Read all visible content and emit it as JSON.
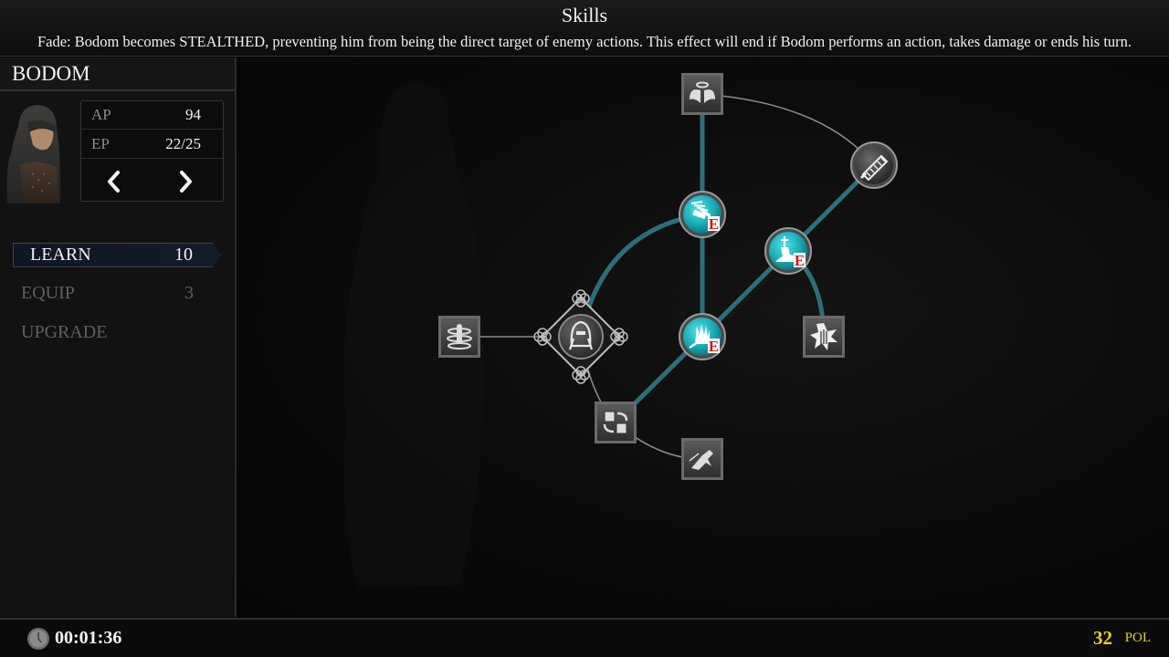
{
  "header": {
    "title": "Skills",
    "description": "Fade: Bodom becomes STEALTHED, preventing him from being the direct target of enemy actions. This effect will end if Bodom performs an action, takes damage or ends his turn."
  },
  "character": {
    "name": "BODOM",
    "stats": [
      {
        "label": "AP",
        "value": "94"
      },
      {
        "label": "EP",
        "value": "22/25"
      }
    ],
    "prev_icon": "chevron-left-icon",
    "next_icon": "chevron-right-icon"
  },
  "menu": [
    {
      "label": "LEARN",
      "count": "10",
      "active": true
    },
    {
      "label": "EQUIP",
      "count": "3",
      "active": false
    },
    {
      "label": "UPGRADE",
      "count": "",
      "active": false
    }
  ],
  "skill_tree": {
    "colors": {
      "learned_link": "#2b6f7c",
      "unlearned_link": "#8a8a8a",
      "learned_node": "#1fb8c4",
      "equipped_badge": "#d01818"
    },
    "nodes": [
      {
        "id": "root",
        "icon": "hooded-figure-icon",
        "kind": "root",
        "learned": true,
        "equipped": false
      },
      {
        "id": "whirl",
        "icon": "whirlwind-figure-icon",
        "kind": "passive",
        "learned": false,
        "equipped": false
      },
      {
        "id": "wings",
        "icon": "winged-halo-icon",
        "kind": "passive",
        "learned": false,
        "equipped": false
      },
      {
        "id": "bandage",
        "icon": "bandaged-hand-icon",
        "kind": "active",
        "learned": true,
        "equipped": true,
        "badge": "E"
      },
      {
        "id": "claw",
        "icon": "clawed-gauntlet-icon",
        "kind": "active",
        "learned": true,
        "equipped": true,
        "badge": "E"
      },
      {
        "id": "kneel",
        "icon": "kneeling-swordsman-icon",
        "kind": "active",
        "learned": true,
        "equipped": true,
        "badge": "E"
      },
      {
        "id": "blade",
        "icon": "serrated-blade-icon",
        "kind": "active",
        "learned": false,
        "equipped": false
      },
      {
        "id": "burst",
        "icon": "fist-burst-icon",
        "kind": "passive",
        "learned": false,
        "equipped": false
      },
      {
        "id": "swap",
        "icon": "swap-squares-icon",
        "kind": "passive",
        "learned": true,
        "equipped": false
      },
      {
        "id": "dash",
        "icon": "dashing-figure-icon",
        "kind": "passive",
        "learned": false,
        "equipped": false
      }
    ],
    "links": [
      {
        "from": "whirl",
        "to": "root",
        "learned": false
      },
      {
        "from": "root",
        "to": "bandage",
        "learned": true
      },
      {
        "from": "root",
        "to": "swap",
        "learned": false
      },
      {
        "from": "swap",
        "to": "claw",
        "learned": true
      },
      {
        "from": "swap",
        "to": "dash",
        "learned": false
      },
      {
        "from": "claw",
        "to": "bandage",
        "learned": true
      },
      {
        "from": "bandage",
        "to": "wings",
        "learned": true
      },
      {
        "from": "wings",
        "to": "blade",
        "learned": false
      },
      {
        "from": "claw",
        "to": "kneel",
        "learned": true
      },
      {
        "from": "kneel",
        "to": "blade",
        "learned": true
      },
      {
        "from": "kneel",
        "to": "burst",
        "learned": true
      }
    ]
  },
  "footer": {
    "timer": "00:01:36",
    "currency_amount": "32",
    "currency_label": "POL",
    "currency_color": "#e6d21e"
  }
}
